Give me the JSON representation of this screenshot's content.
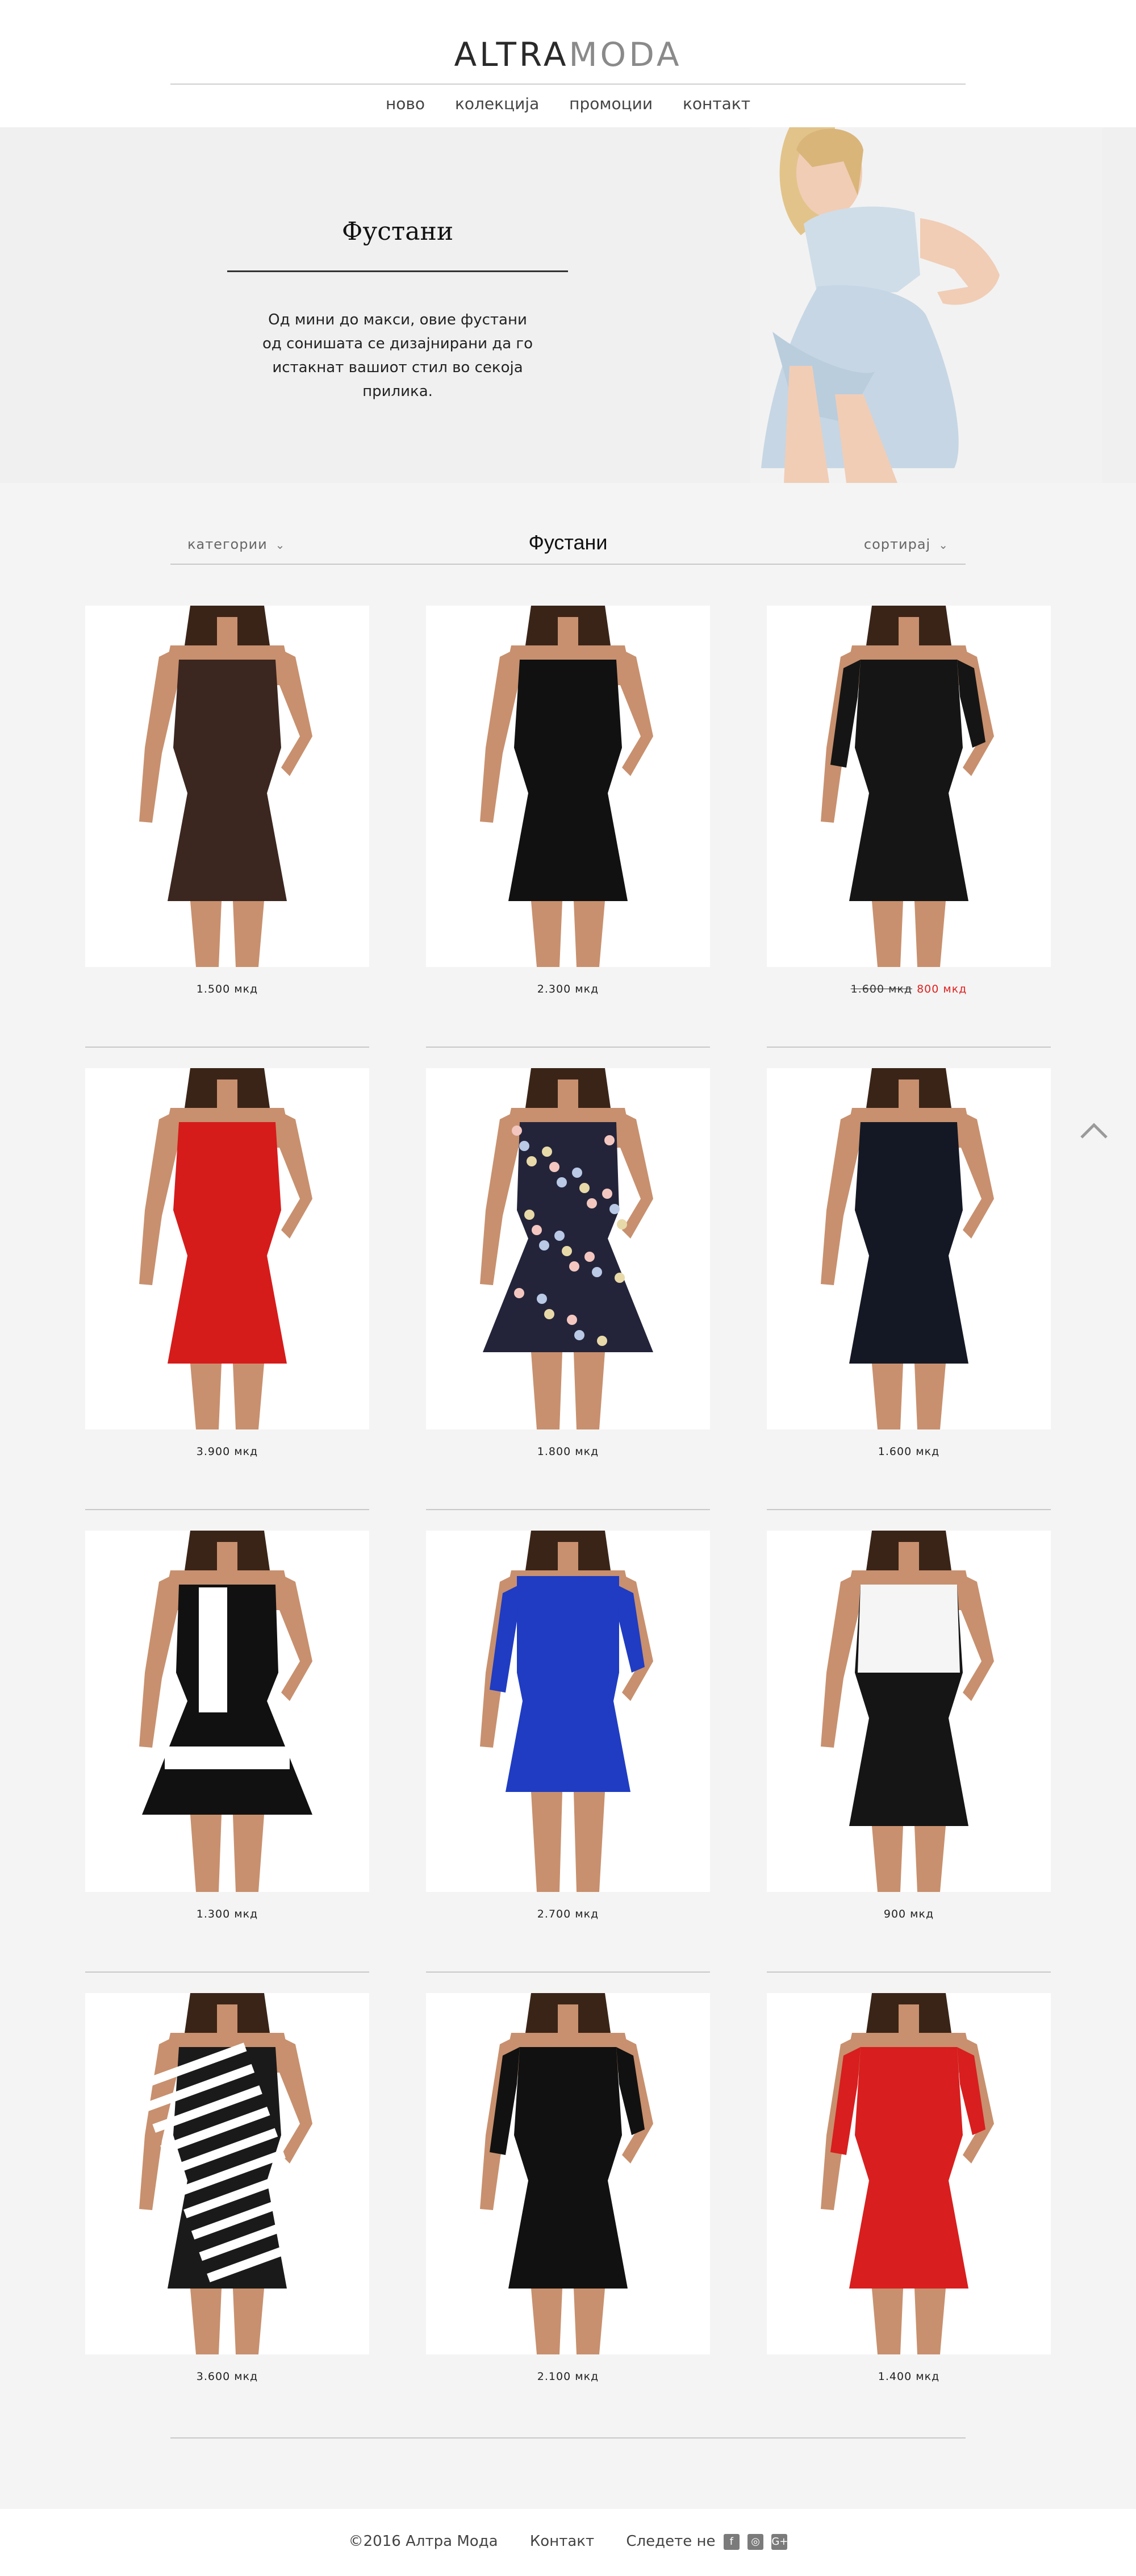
{
  "brand": {
    "part1": "ALTRA",
    "part2": "MODA"
  },
  "nav": [
    "ново",
    "колекција",
    "промоции",
    "контакт"
  ],
  "hero": {
    "title": "Фустани",
    "text": "Од мини до макси, овие фустани од сонишата се дизајнирани да го истакнат вашиот стил во секоја прилика."
  },
  "filterbar": {
    "categories": "категории",
    "title": "Фустани",
    "sort": "сортирај"
  },
  "products": [
    {
      "price": "1.500 мкд",
      "dress": "#3b2620",
      "style": "sleeveless"
    },
    {
      "price": "2.300 мкд",
      "dress": "#111111",
      "style": "oneshoulder"
    },
    {
      "price_old": "1.600 мкд",
      "price_new": "800 мкд",
      "dress": "#151515",
      "style": "sleeves"
    },
    {
      "price": "3.900 мкд",
      "dress": "#d61b1b",
      "style": "sleeveless"
    },
    {
      "price": "1.800 мкд",
      "dress": "#23243a",
      "style": "floral"
    },
    {
      "price": "1.600 мкд",
      "dress": "#141824",
      "style": "vneck"
    },
    {
      "price": "1.300 мкд",
      "dress": "#111111",
      "style": "stripe"
    },
    {
      "price": "2.700 мкд",
      "dress": "#1f3cc2",
      "style": "romper"
    },
    {
      "price": "900 мкд",
      "dress": "#151515",
      "style": "twotone"
    },
    {
      "price": "3.600 мкд",
      "dress": "#1a1a1a",
      "style": "zebra"
    },
    {
      "price": "2.100 мкд",
      "dress": "#111111",
      "style": "sleeves"
    },
    {
      "price": "1.400 мкд",
      "dress": "#d81e1e",
      "style": "sleeves"
    }
  ],
  "footer": {
    "copyright": "©2016 Алтра Мода",
    "contact": "Контакт",
    "follow": "Следете не",
    "social": [
      "f",
      "◎",
      "G+"
    ]
  },
  "icons": {
    "back_to_top": "chevron-up-icon"
  }
}
